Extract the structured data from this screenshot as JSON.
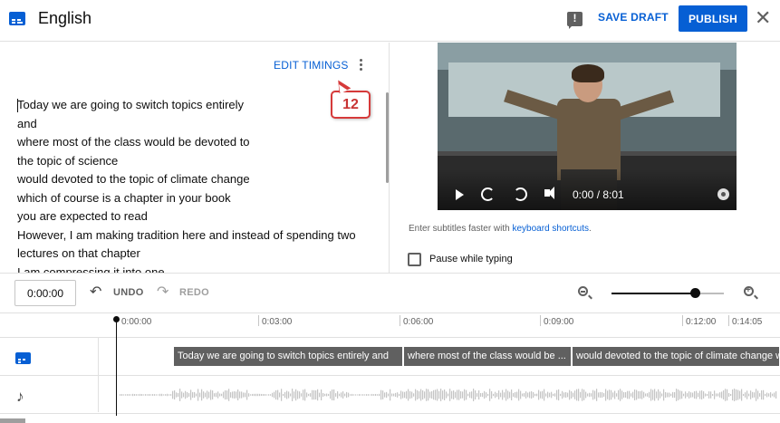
{
  "header": {
    "title": "English",
    "save_draft_label": "SAVE DRAFT",
    "publish_label": "PUBLISH",
    "close_glyph": "✕",
    "icons": [
      "subtitles-icon",
      "feedback-icon",
      "close-icon"
    ]
  },
  "editor": {
    "edit_timings_label": "EDIT TIMINGS",
    "callout_number": "12",
    "lines": [
      "Today we are going to switch topics entirely",
      "and",
      "where most of the class would be devoted to",
      "the topic of science",
      "would devoted to the topic of climate change",
      "which of course is a chapter in your book",
      "you are expected to read",
      "However, I am making tradition here and instead of spending two",
      "lectures on that chapter",
      "I am compressing it into one"
    ]
  },
  "preview": {
    "time_display": "0:00 / 8:01",
    "shortcut_prefix": "Enter subtitles faster with ",
    "shortcut_link": "keyboard shortcuts",
    "shortcut_suffix": ".",
    "pause_label": "Pause while typing",
    "pause_checked": false
  },
  "toolbar": {
    "time_value": "0:00:00",
    "undo_label": "UNDO",
    "redo_label": "REDO",
    "zoom_level_fraction": 0.74
  },
  "timeline": {
    "ruler_labels": [
      "0:00:00",
      "0:03:00",
      "0:06:00",
      "0:09:00",
      "0:12:00",
      "0:14:05"
    ],
    "segments": [
      "Today we are going to switch topics entirely and",
      "where most of the class would be ...",
      "would devoted to the topic of climate change w..."
    ]
  },
  "colors": {
    "accent": "#065fd4",
    "segment_bg": "#606060",
    "callout_red": "#d63a3a"
  }
}
